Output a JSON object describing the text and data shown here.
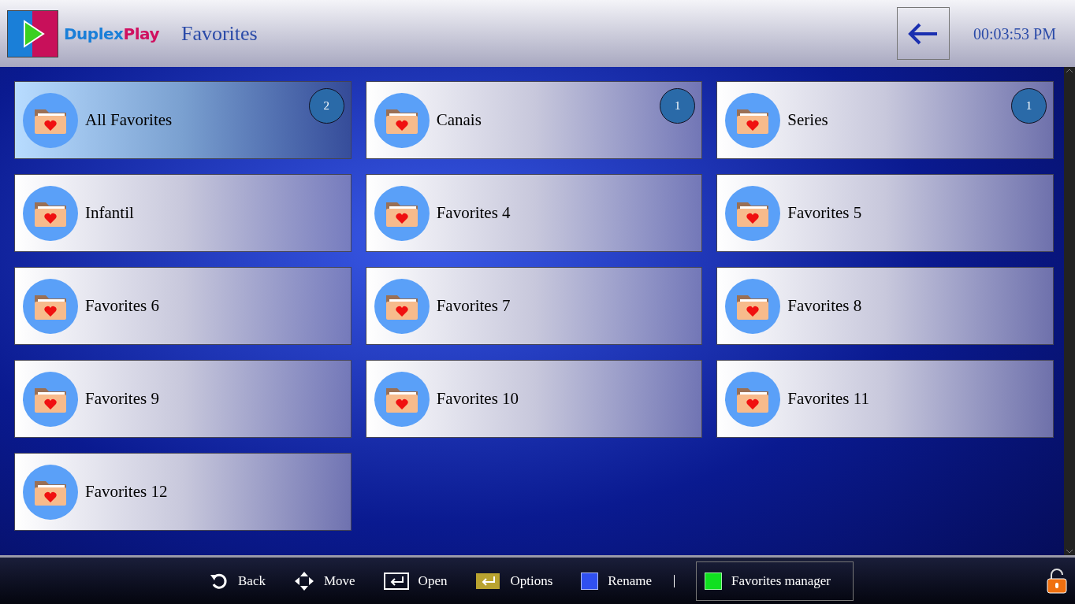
{
  "header": {
    "logo": {
      "part_1": "Duplex",
      "part_2": "Play"
    },
    "title": "Favorites",
    "clock": "00:03:53 PM"
  },
  "folders": [
    {
      "label": "All Favorites",
      "count": "2",
      "selected": true
    },
    {
      "label": "Canais",
      "count": "1",
      "selected": false
    },
    {
      "label": "Series",
      "count": "1",
      "selected": false
    },
    {
      "label": "Infantil",
      "selected": false
    },
    {
      "label": "Favorites 4",
      "selected": false
    },
    {
      "label": "Favorites 5",
      "selected": false
    },
    {
      "label": "Favorites 6",
      "selected": false
    },
    {
      "label": "Favorites 7",
      "selected": false
    },
    {
      "label": "Favorites 8",
      "selected": false
    },
    {
      "label": "Favorites 9",
      "selected": false
    },
    {
      "label": "Favorites 10",
      "selected": false
    },
    {
      "label": "Favorites 11",
      "selected": false
    },
    {
      "label": "Favorites 12",
      "selected": false
    }
  ],
  "footer_hints": [
    {
      "kind": "back",
      "label": "Back"
    },
    {
      "kind": "move",
      "label": "Move"
    },
    {
      "kind": "open",
      "label": "Open"
    },
    {
      "kind": "options",
      "label": "Options",
      "color": "#b9a330"
    },
    {
      "kind": "key",
      "label": "Rename",
      "color": "#3050f0"
    },
    {
      "kind": "key",
      "label": "Favorites manager",
      "color": "#10e020",
      "boxed": true
    }
  ]
}
